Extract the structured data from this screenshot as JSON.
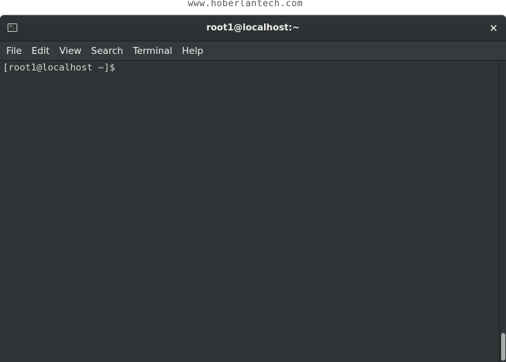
{
  "watermark": "www.hoberlantech.com",
  "window": {
    "title": "root1@localhost:~",
    "close_symbol": "✕",
    "title_icon": "terminal-icon"
  },
  "menubar": {
    "items": [
      {
        "label": "File"
      },
      {
        "label": "Edit"
      },
      {
        "label": "View"
      },
      {
        "label": "Search"
      },
      {
        "label": "Terminal"
      },
      {
        "label": "Help"
      }
    ]
  },
  "terminal": {
    "prompt": "[root1@localhost ~]$ "
  },
  "colors": {
    "background": "#2e3436",
    "text": "#d3d7cf",
    "titlebar": "#2f3436",
    "menubar": "#353b3d"
  }
}
